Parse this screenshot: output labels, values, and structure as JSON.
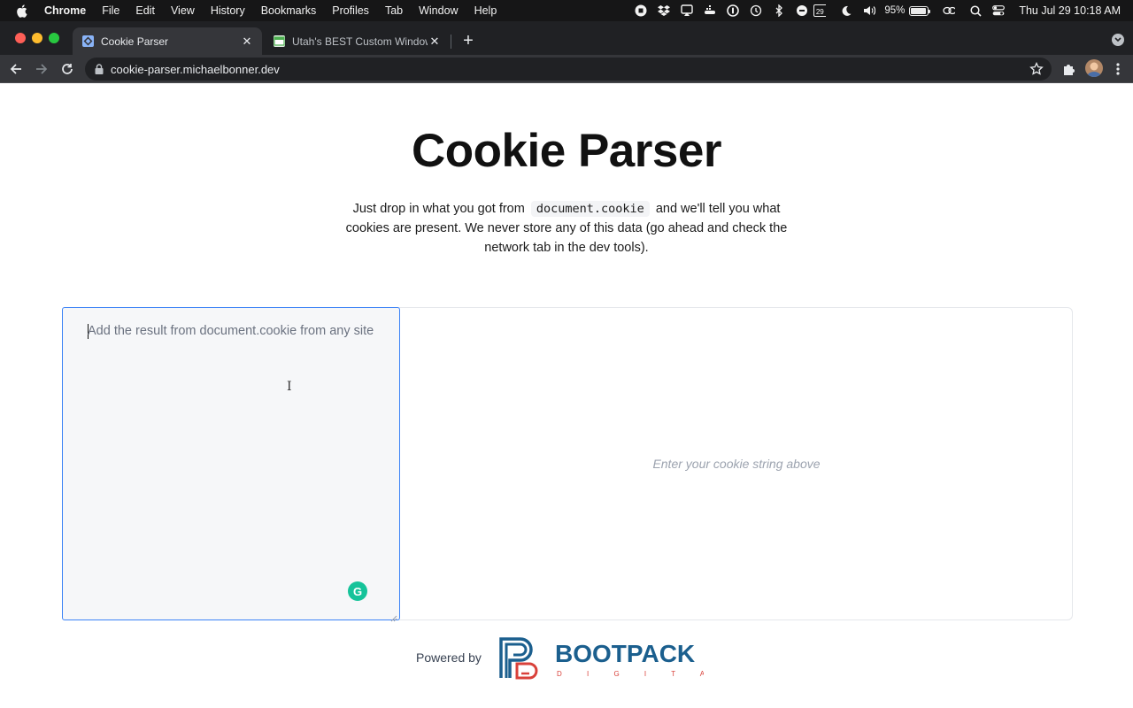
{
  "menubar": {
    "app_name": "Chrome",
    "menus": [
      "File",
      "Edit",
      "View",
      "History",
      "Bookmarks",
      "Profiles",
      "Tab",
      "Window",
      "Help"
    ],
    "battery": "95%",
    "battery_level": 0.95,
    "calendar_day": "29",
    "clock": "Thu Jul 29  10:18 AM"
  },
  "browser": {
    "tabs": [
      {
        "title": "Cookie Parser",
        "active": true
      },
      {
        "title": "Utah's BEST Custom Window T",
        "active": false
      }
    ],
    "url": "cookie-parser.michaelbonner.dev"
  },
  "page": {
    "title": "Cookie Parser",
    "intro_before": "Just drop in what you got from",
    "intro_code": "document.cookie",
    "intro_after": "and we'll tell you what cookies are present. We never store any of this data (go ahead and check the network tab in the dev tools).",
    "input": {
      "placeholder": "Add the result from document.cookie from any site",
      "value": ""
    },
    "empty_state": "Enter your cookie string above",
    "footer": {
      "powered_by": "Powered by",
      "logo_text": "BOOTPACK",
      "logo_subtext": "D I G I T A L"
    }
  },
  "colors": {
    "focus_ring": "#3b82f6",
    "logo_blue": "#1b5f8e",
    "logo_red": "#d9413a",
    "grammarly": "#15c39a"
  }
}
